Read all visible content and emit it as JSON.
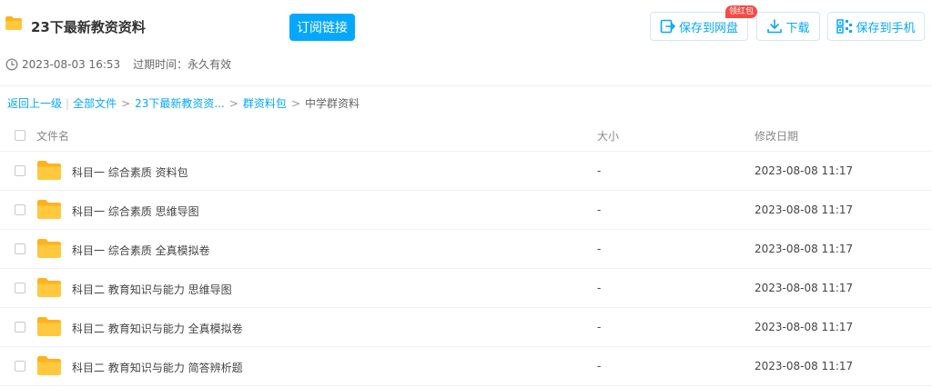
{
  "header": {
    "title": "23下最新教资资料",
    "subscribe_label": "订阅链接",
    "save_to_disk_label": "保存到网盘",
    "red_packet_badge": "领红包",
    "download_label": "下载",
    "save_to_phone_label": "保存到手机"
  },
  "meta": {
    "share_time": "2023-08-03 16:53",
    "expire_label": "过期时间：永久有效"
  },
  "breadcrumb": {
    "back": "返回上一级",
    "all_files": "全部文件",
    "level1": "23下最新教资资...",
    "level2": "群资料包",
    "current": "中学群资料",
    "separator": ">",
    "divider": "|"
  },
  "table": {
    "col_name": "文件名",
    "col_size": "大小",
    "col_date": "修改日期",
    "rows": [
      {
        "name": "科目一 综合素质 资料包",
        "size": "-",
        "date": "2023-08-08 11:17"
      },
      {
        "name": "科目一 综合素质 思维导图",
        "size": "-",
        "date": "2023-08-08 11:17"
      },
      {
        "name": "科目一 综合素质 全真模拟卷",
        "size": "-",
        "date": "2023-08-08 11:17"
      },
      {
        "name": "科目二 教育知识与能力 思维导图",
        "size": "-",
        "date": "2023-08-08 11:17"
      },
      {
        "name": "科目二 教育知识与能力 全真模拟卷",
        "size": "-",
        "date": "2023-08-08 11:17"
      },
      {
        "name": "科目二 教育知识与能力 简答辨析题",
        "size": "-",
        "date": "2023-08-08 11:17"
      }
    ]
  },
  "icons": {
    "folder": "folder-icon",
    "clock": "clock-icon",
    "save": "save-to-disk-icon",
    "download": "download-icon",
    "phone": "qr-phone-icon"
  },
  "colors": {
    "accent": "#06a7ff",
    "folder": "#ffc83d",
    "badge": "#f54a45"
  }
}
